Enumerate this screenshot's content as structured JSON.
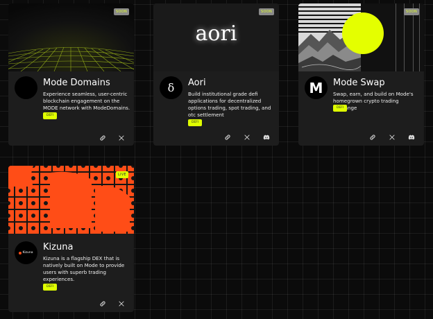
{
  "projects": [
    {
      "name": "Mode Domains",
      "description": "Experience seamless, user-centric blockchain engagement on the MODE network with ModeDomains.",
      "tag": "DEFI",
      "status": "SOON",
      "logo_text": ""
    },
    {
      "name": "Aori",
      "banner_text": "aori",
      "description": "Build institutional grade defi applications for decentralized options trading, spot trading, and otc settlement",
      "tag": "DEFI",
      "status": "SOON",
      "logo_text": "δ"
    },
    {
      "name": "Mode Swap",
      "description": "Swap, earn, and build on Mode's homegrown crypto trading exchange",
      "tag": "DEFI",
      "status": "SOON",
      "logo_text": "M"
    },
    {
      "name": "Kizuna",
      "description": "Kizuna is a flagship DEX that is natively built on Mode to provide users with superb trading experiences.",
      "tag": "DEFI",
      "status": "LIVE",
      "logo_text": "Kizuna"
    }
  ],
  "icons": {
    "link": "link-icon",
    "x": "x-icon",
    "discord": "discord-icon"
  },
  "colors": {
    "accent": "#dfff00",
    "card": "#1d1d1d",
    "kizuna_orange": "#ff4d17"
  }
}
